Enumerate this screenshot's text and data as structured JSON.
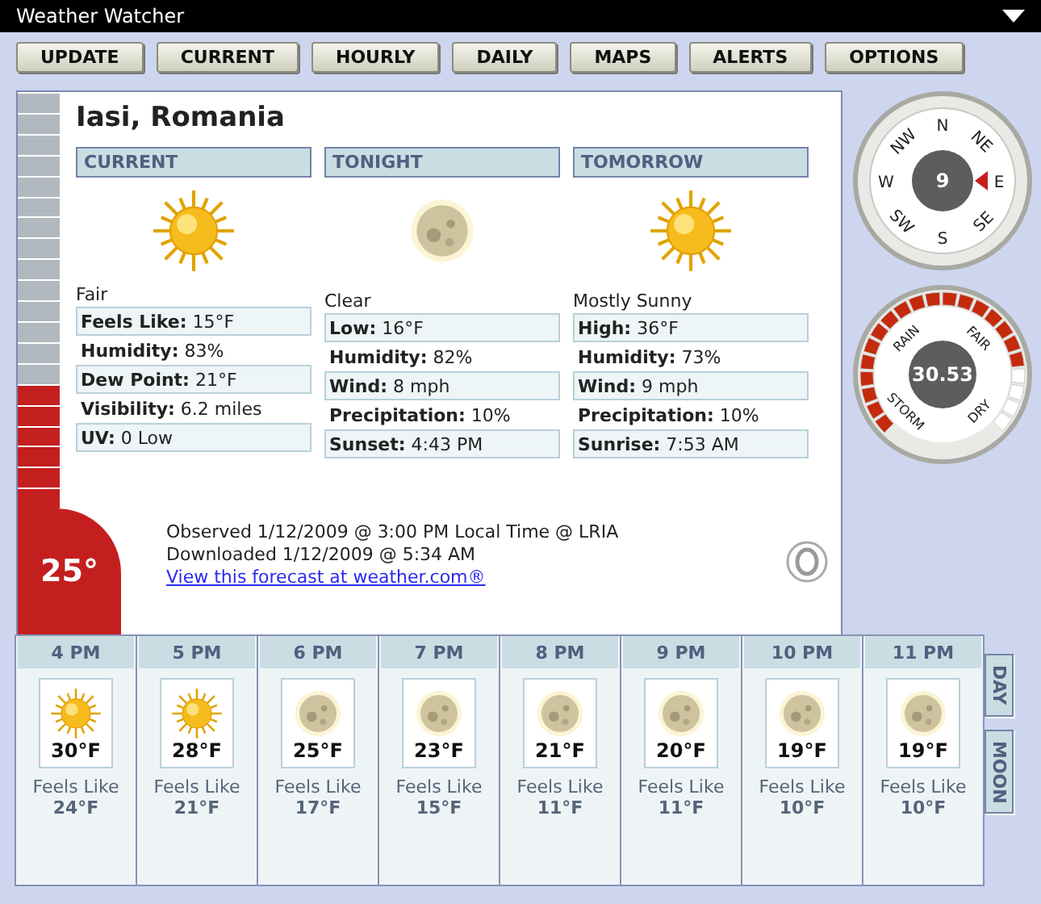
{
  "window": {
    "title": "Weather Watcher"
  },
  "toolbar": [
    "UPDATE",
    "CURRENT",
    "HOURLY",
    "DAILY",
    "MAPS",
    "ALERTS",
    "OPTIONS"
  ],
  "location": "Iasi, Romania",
  "thermometer": {
    "level": 0.3,
    "reading": "25°"
  },
  "forecast": [
    {
      "title": "CURRENT",
      "kind": "sun",
      "condition": "Fair",
      "rows": [
        {
          "label": "Feels Like:",
          "value": "15°F"
        },
        {
          "label": "Humidity:",
          "value": "83%"
        },
        {
          "label": "Dew Point:",
          "value": "21°F"
        },
        {
          "label": "Visibility:",
          "value": "6.2 miles"
        },
        {
          "label": "UV:",
          "value": "0 Low"
        }
      ]
    },
    {
      "title": "TONIGHT",
      "kind": "moon",
      "condition": "Clear",
      "rows": [
        {
          "label": "Low:",
          "value": "16°F"
        },
        {
          "label": "Humidity:",
          "value": "82%"
        },
        {
          "label": "Wind:",
          "value": "8 mph"
        },
        {
          "label": "Precipitation:",
          "value": "10%"
        },
        {
          "label": "Sunset:",
          "value": "4:43 PM"
        }
      ]
    },
    {
      "title": "TOMORROW",
      "kind": "sun",
      "condition": "Mostly Sunny",
      "rows": [
        {
          "label": "High:",
          "value": "36°F"
        },
        {
          "label": "Humidity:",
          "value": "73%"
        },
        {
          "label": "Wind:",
          "value": "9 mph"
        },
        {
          "label": "Precipitation:",
          "value": "10%"
        },
        {
          "label": "Sunrise:",
          "value": "7:53 AM"
        }
      ]
    }
  ],
  "compass": {
    "speed": "9",
    "directions": [
      {
        "label": "N",
        "selected": false
      },
      {
        "label": "NE",
        "selected": false
      },
      {
        "label": "E",
        "selected": true
      },
      {
        "label": "SE",
        "selected": false
      },
      {
        "label": "S",
        "selected": false
      },
      {
        "label": "SW",
        "selected": false
      },
      {
        "label": "W",
        "selected": false
      },
      {
        "label": "NW",
        "selected": false
      }
    ]
  },
  "barometer": {
    "reading": "30.53",
    "level": 0.8,
    "labels": [
      "RAIN",
      "FAIR",
      "STORM",
      "DRY"
    ]
  },
  "info": {
    "observed": "Observed 1/12/2009 @ 3:00 PM Local Time @ LRIA",
    "downloaded": "Downloaded 1/12/2009 @ 5:34 AM",
    "link": "View this forecast at weather.com®"
  },
  "hourly": [
    {
      "time": "4 PM",
      "kind": "sun",
      "temp": "30°F",
      "feels_label": "Feels Like",
      "feels": "24°F"
    },
    {
      "time": "5 PM",
      "kind": "sun",
      "temp": "28°F",
      "feels_label": "Feels Like",
      "feels": "21°F"
    },
    {
      "time": "6 PM",
      "kind": "moon",
      "temp": "25°F",
      "feels_label": "Feels Like",
      "feels": "17°F"
    },
    {
      "time": "7 PM",
      "kind": "moon",
      "temp": "23°F",
      "feels_label": "Feels Like",
      "feels": "15°F"
    },
    {
      "time": "8 PM",
      "kind": "moon",
      "temp": "21°F",
      "feels_label": "Feels Like",
      "feels": "11°F"
    },
    {
      "time": "9 PM",
      "kind": "moon",
      "temp": "20°F",
      "feels_label": "Feels Like",
      "feels": "11°F"
    },
    {
      "time": "10 PM",
      "kind": "moon",
      "temp": "19°F",
      "feels_label": "Feels Like",
      "feels": "10°F"
    },
    {
      "time": "11 PM",
      "kind": "moon",
      "temp": "19°F",
      "feels_label": "Feels Like",
      "feels": "10°F"
    }
  ],
  "side_tabs": [
    "DAY",
    "MOON"
  ]
}
